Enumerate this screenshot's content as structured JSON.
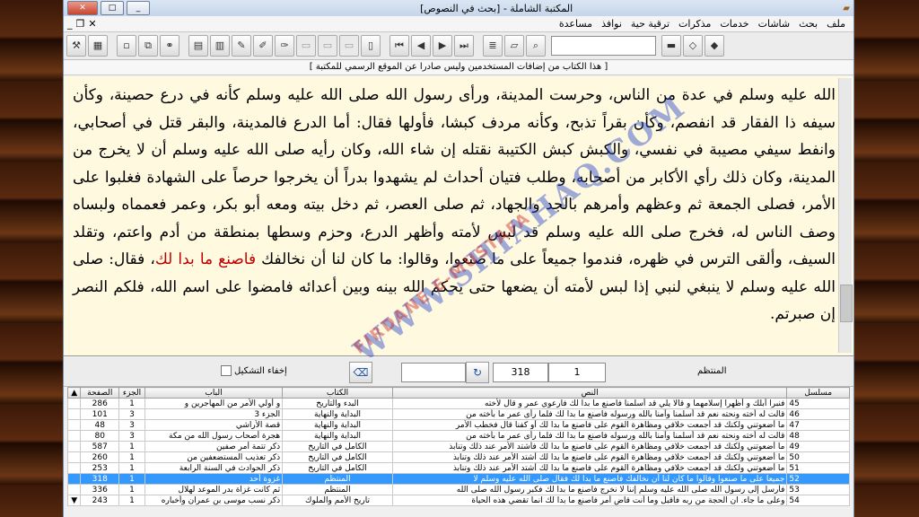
{
  "window": {
    "title": "المكتبة الشاملة - [بحث في النصوص]"
  },
  "menu": {
    "items": [
      "ملف",
      "بحث",
      "شاشات",
      "خدمات",
      "مذكرات",
      "ترقية حية",
      "نوافذ",
      "مساعدة"
    ]
  },
  "toolbar": {
    "buttons": [
      "home-icon",
      "bookmark-icon",
      "book-icon",
      "book-alt-icon",
      "binoculars-icon",
      "folder-icon",
      "list-icon",
      "first-icon",
      "prev-icon",
      "next-icon",
      "last-icon",
      "book-open-icon",
      "blank-icon",
      "blank-icon",
      "blank-icon",
      "pen-icon",
      "pen-alt-icon",
      "doc-icon",
      "doc-alt-icon",
      "copy-icon",
      "new-icon",
      "grid-icon",
      "calc-icon",
      "tools-icon"
    ]
  },
  "notice": "[ هذا الكتاب من إضافات المستخدمين وليس صادرا عن الموقع الرسمي للمكتبة ]",
  "text": {
    "p1": "الله عليه وسلم في عدة من الناس، وحرست المدينة، ورأى رسول الله صلى الله عليه وسلم كأنه في درع حصينة، وكأن سيفه ذا الفقار قد انفصم، وكأن بقراً تذبح، وكأنه مردف كبشا، فأولها فقال: أما الدرع فالمدينة، والبقر قتل في أصحابي، وانفط سيفي مصيبة في نفسي، والكبش كبش الكتيبة نقتله إن شاء الله، وكان رأيه صلى الله عليه وسلم أن لا يخرج من المدينة، وكان ذلك رأي الأكابر من أصحابه، وطلب فتيان أحداث لم يشهدوا بدراً أن يخرجوا حرصاً على الشهادة فغلبوا على الأمر، فصلى الجمعة ثم وعظهم وأمرهم بالجد والجهاد، ثم صلى العصر، ثم دخل بيته ومعه أبو بكر، وعمر فعمماه ولبساه وصف الناس له، فخرج صلى الله عليه وسلم قد لبس لأمته وأظهر الدرع، وحزم وسطها بمنطقة من أدم واعتم، وتقلد السيف، وألقى الترس في ظهره، فندموا جميعاً على ما صنعوا، وقالوا: ما كان لنا أن نخالفك ",
    "highlight": "فاصنع ما بدا لك",
    "p2": "، فقال: صلى الله عليه وسلم لا ينبغي لنبي إذا لبس لأمته أن يضعها حتى يحكم الله بينه وبين أعدائه فامضوا على اسم الله، فلكم النصر إن صبرتم."
  },
  "watermark": {
    "line1": "WWW.SHIAHAQ.COM",
    "line2": "FIRDANE E-MUSTAFA"
  },
  "controls": {
    "hide_diacritics": "إخفاء التشكيل",
    "field_a": "318",
    "field_b": "1",
    "book_label": "المنتظم"
  },
  "table": {
    "headers": [
      "مسلسل",
      "النص",
      "الكتاب",
      "الباب",
      "الجزء",
      "الصفحة"
    ],
    "rows": [
      [
        "45",
        "فنبرا أبلك و أظهرا إسلامهما و قالا يلي قد أسلمنا فاصنع ما بدا لك فارعوي عمر و قال لأخته",
        "البدء والتاريخ",
        "و أولي الأمر من المهاجرين و",
        "1",
        "286"
      ],
      [
        "46",
        "قالت له أخته ونحته نعم قد أسلمنا وآمنا بالله ورسوله فاصنع ما بدا لك فلما رأى عمر ما بأخته من",
        "البداية والنهاية",
        "الجزء 3",
        "3",
        "101"
      ],
      [
        "47",
        "ما أضعوتني ولكنك قد أجمعت خلافي ومظاهرة القوم على فاصنع ما بدا لك أو كفنا قال فخطب الأمر",
        "البداية والنهاية",
        "قصة الأراشي",
        "3",
        "48"
      ],
      [
        "48",
        "قالت له أخته ونحته نعم قد أسلمنا وآمنا بالله ورسوله فاصنع ما بدا لك فلما رأى عمر ما بأخته من",
        "البداية والنهاية",
        "هجرة أصحاب رسول الله من مكة",
        "3",
        "80"
      ],
      [
        "49",
        "ما أضعوتني ولكنك قد أجمعت خلافي ومظاهرة القوم على فاصنع ما بدا لك فأشتد الأمر عند ذلك وتنابذ",
        "الكامل في التاريخ",
        "ذكر تتمة أمر صفين",
        "1",
        "587"
      ],
      [
        "50",
        "ما أضعوتني ولكنك قد أجمعت خلافي ومظاهرة القوم على فاصنع ما بدا لك أشتد الأمر عند ذلك وتنابذ",
        "الكامل في التاريخ",
        "ذكر تعذيب المستضعفين من",
        "1",
        "260"
      ],
      [
        "51",
        "ما أضعوتني ولكنك قد أجمعت خلافي ومظاهرة القوم على فاصنع ما بدا لك أشتد الأمر عند ذلك وتنابذ",
        "الكامل في التاريخ",
        "ذكر الحوادث في السنة الرابعة",
        "1",
        "253"
      ],
      [
        "52",
        "جميعا على ما صنعوا وقالوا ما كان لنا أن نخالفك فاصنع ما بدا لك فقال صلى الله عليه وسلم لا",
        "المنتظم",
        "غزوة أحد",
        "1",
        "318"
      ],
      [
        "53",
        "فأرسل إلى رسول الله صلى الله عليه وسلم إننا لا نخرج فاصنع ما بدا لك فكبر رسول الله صلى الله",
        "المنتظم",
        "ثم كانت غزاة بدر الموعد لهلال",
        "1",
        "336"
      ],
      [
        "54",
        "وعلى ما جاء. ان الحجة من ربه فأقبل وما أنت قاض أمر فاصنع ما بدا لك انما تقضي هذه الحياة",
        "تاريخ الأمم والملوك",
        "ذكر نسب موسى بن عمران وأخباره",
        "1",
        "243"
      ]
    ],
    "selected_index": 7
  }
}
